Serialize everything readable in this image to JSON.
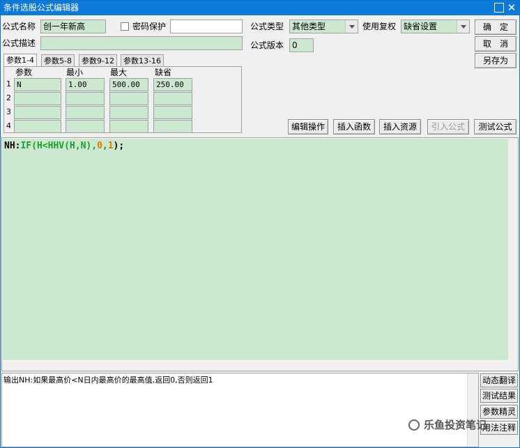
{
  "window": {
    "title": "条件选股公式编辑器"
  },
  "form": {
    "name_label": "公式名称",
    "name_value": "创一年新高",
    "password_label": "密码保护",
    "password_value": "",
    "desc_label": "公式描述",
    "desc_value": "",
    "type_label": "公式类型",
    "type_value": "其他类型",
    "reuse_label": "使用复权",
    "reuse_value": "缺省设置",
    "version_label": "公式版本",
    "version_value": "0"
  },
  "buttons": {
    "ok": "确　定",
    "cancel": "取　消",
    "save_as": "另存为",
    "edit_op": "编辑操作",
    "insert_func": "插入函数",
    "insert_res": "插入资源",
    "import_formula": "引入公式",
    "test_formula": "测试公式"
  },
  "tabs": [
    "参数1-4",
    "参数5-8",
    "参数9-12",
    "参数13-16"
  ],
  "params": {
    "headers": [
      "参数",
      "最小",
      "最大",
      "缺省"
    ],
    "rows": [
      {
        "num": "1",
        "name": "N",
        "min": "1.00",
        "max": "500.00",
        "default": "250.00"
      },
      {
        "num": "2",
        "name": "",
        "min": "",
        "max": "",
        "default": ""
      },
      {
        "num": "3",
        "name": "",
        "min": "",
        "max": "",
        "default": ""
      },
      {
        "num": "4",
        "name": "",
        "min": "",
        "max": "",
        "default": ""
      }
    ]
  },
  "code": {
    "t1": "NH:",
    "t2": "IF(H<HHV(H,N),",
    "t3": "0",
    "t4": ",",
    "t5": "1",
    "t6": ");"
  },
  "output": {
    "text": "输出NH:如果最高价<N日内最高价的最高值,返回0,否则返回1"
  },
  "side_buttons": [
    "动态翻译",
    "测试结果",
    "参数精灵",
    "用法注释"
  ],
  "watermark": "乐鱼投资笔记"
}
